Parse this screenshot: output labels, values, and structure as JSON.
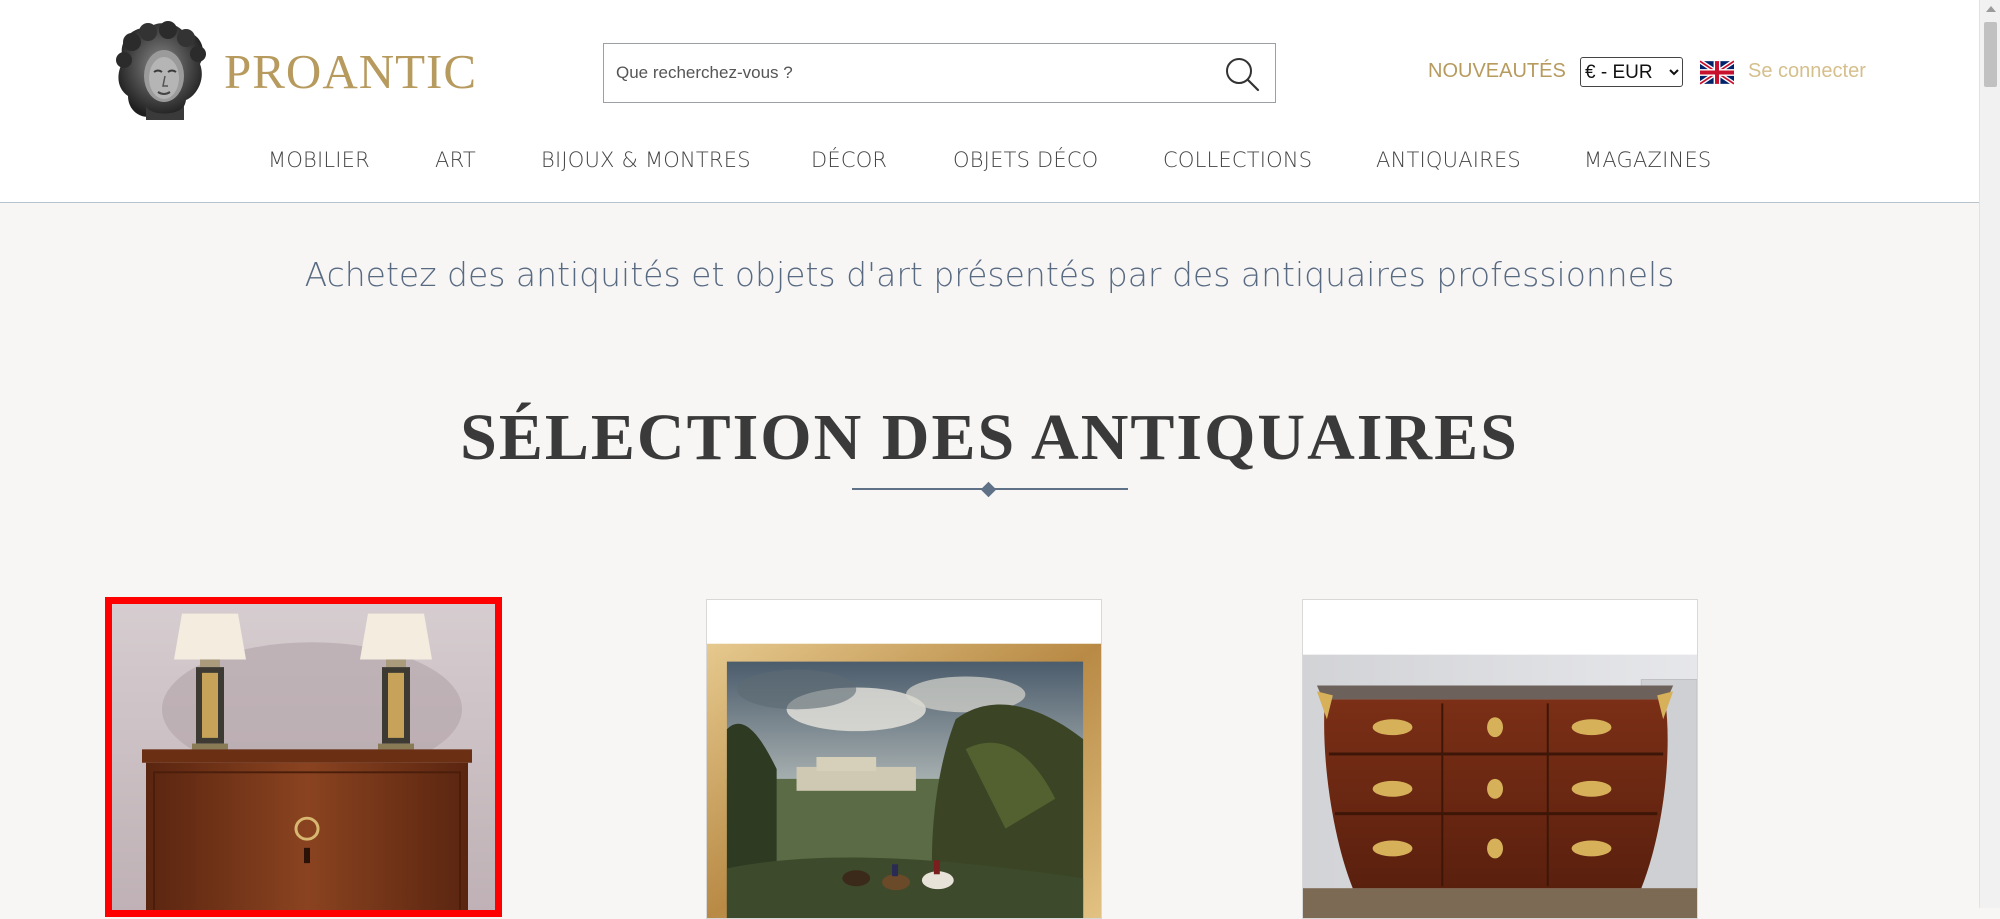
{
  "brand": {
    "name": "PROANTIC"
  },
  "search": {
    "placeholder": "Que recherchez-vous ?"
  },
  "header": {
    "new_label": "NOUVEAUTÉS",
    "currency": {
      "selected": "€ - EUR",
      "options": [
        "€ - EUR"
      ]
    },
    "language_icon": "uk-flag-icon",
    "login_label": "Se connecter"
  },
  "nav": {
    "items": [
      {
        "label": "MOBILIER"
      },
      {
        "label": "ART"
      },
      {
        "label": "BIJOUX & MONTRES"
      },
      {
        "label": "DÉCOR"
      },
      {
        "label": "OBJETS DÉCO"
      },
      {
        "label": "COLLECTIONS"
      },
      {
        "label": "ANTIQUAIRES"
      },
      {
        "label": "MAGAZINES"
      }
    ]
  },
  "main": {
    "tagline": "Achetez des antiquités et objets d'art présentés par des antiquaires professionnels",
    "section_title": "SÉLECTION DES ANTIQUAIRES",
    "cards": [
      {
        "image": "mahogany-cabinet-with-lamps",
        "selected": true
      },
      {
        "image": "framed-landscape-hunt-painting",
        "selected": false
      },
      {
        "image": "louis-xv-marquetry-commode",
        "selected": false
      }
    ]
  },
  "colors": {
    "brand_gold": "#b79a5e",
    "login_gold": "#d5bf8c",
    "tagline_blue": "#586a82",
    "selection_red": "#ff0000",
    "background": "#f7f6f5"
  }
}
